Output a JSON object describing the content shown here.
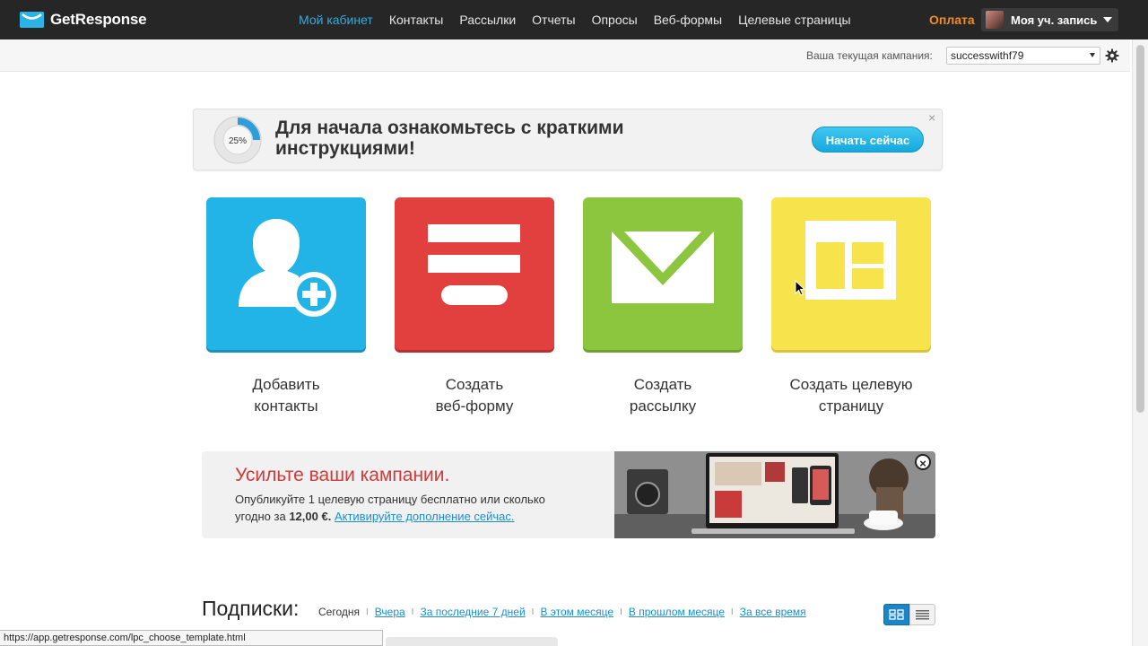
{
  "header": {
    "logo_text": "GetResponse",
    "nav": [
      {
        "label": "Мой кабинет",
        "active": true
      },
      {
        "label": "Контакты"
      },
      {
        "label": "Рассылки"
      },
      {
        "label": "Отчеты"
      },
      {
        "label": "Опросы"
      },
      {
        "label": "Веб-формы"
      },
      {
        "label": "Целевые страницы"
      }
    ],
    "pay_label": "Оплата",
    "account_label": "Моя уч. запись"
  },
  "campaign": {
    "label": "Ваша текущая кампания:",
    "selected": "successwithf79"
  },
  "intro": {
    "progress_label": "25%",
    "progress_fraction": 0.25,
    "title": "Для начала ознакомьтесь с краткими инструкциями!",
    "button_label": "Начать сейчас",
    "close_label": "×"
  },
  "tiles": [
    {
      "line1": "Добавить",
      "line2": "контакты"
    },
    {
      "line1": "Создать",
      "line2": "веб-форму"
    },
    {
      "line1": "Создать",
      "line2": "рассылку"
    },
    {
      "line1": "Создать целевую",
      "line2": "страницу"
    }
  ],
  "promo": {
    "title": "Усильте ваши кампании.",
    "text_before": "Опубликуйте 1 целевую страницу бесплатно или сколько угодно за",
    "price": "12,00 €.",
    "link_label": "Активируйте дополнение сейчас.",
    "close_label": "×"
  },
  "subscriptions": {
    "title": "Подписки:",
    "filters": [
      "Сегодня",
      "Вчера",
      "За последние 7 дней",
      "В этом месяце",
      "В прошлом месяце",
      "За все время"
    ],
    "separator": "I"
  },
  "status_bar": {
    "url": "https://app.getresponse.com/lpc_choose_template.html"
  },
  "colors": {
    "nav_bg": "#262626",
    "active_nav": "#3fa9d8",
    "pay": "#f28c28",
    "tile_contacts": "#22b4e6",
    "tile_webform": "#e23f3f",
    "tile_newsletter": "#8cc63f",
    "tile_landing": "#f7e34c"
  }
}
